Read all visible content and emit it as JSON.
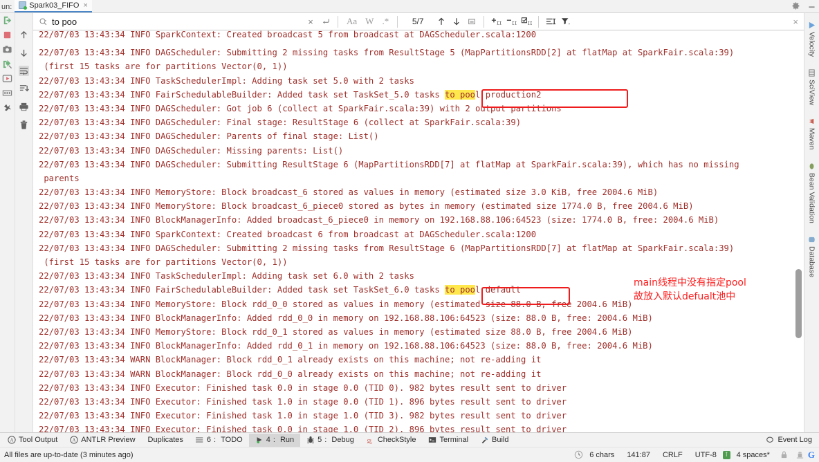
{
  "window": {
    "run_prefix": "un:",
    "tab_label": "Spark03_FIFO",
    "tab_close": "×",
    "gear_icon": "gear-icon",
    "minimize_icon": "minimize-icon"
  },
  "left_rail": {
    "icons": [
      {
        "name": "rerun-icon",
        "glyph": "rerun"
      },
      {
        "name": "stop-icon",
        "glyph": "stop"
      },
      {
        "name": "camera-icon",
        "glyph": "camera"
      },
      {
        "name": "rerun-failed-icon",
        "glyph": "rerun-failed"
      },
      {
        "name": "resume-icon",
        "glyph": "resume"
      },
      {
        "name": "layout-icon",
        "glyph": "layout"
      },
      {
        "name": "pin-icon",
        "glyph": "pin"
      }
    ],
    "icons2": [
      {
        "name": "scroll-up-icon",
        "glyph": "arrow-up"
      },
      {
        "name": "scroll-down-icon",
        "glyph": "arrow-down"
      },
      {
        "name": "soft-wrap-icon",
        "glyph": "soft-wrap",
        "selected": true
      },
      {
        "name": "scroll-to-end-icon",
        "glyph": "scroll-end"
      },
      {
        "name": "print-icon",
        "glyph": "printer"
      },
      {
        "name": "clear-all-icon",
        "glyph": "trash"
      }
    ]
  },
  "findbar": {
    "search_icon": "search-icon",
    "query": "to poo",
    "clear_label": "×",
    "history_label": "↵",
    "match_case_label": "Aa",
    "words_label": "W",
    "regex_label": ".*",
    "count": "5/7",
    "prev_label": "↑",
    "next_label": "↓",
    "select_all_label": "select-all",
    "filter_add_label": "add-filter",
    "filter_remove_label": "remove-filter",
    "filter_check_label": "check-filter",
    "indent_label": "indent",
    "funnel_label": "funnel",
    "close_label": "×"
  },
  "console": {
    "highlight_term": "to poo",
    "lines": [
      {
        "pre": "22/07/03 13:43:34 INFO SparkContext: Created broadcast 5 from broadcast at DAGScheduler.scala:1200",
        "clip": true
      },
      {
        "pre": "22/07/03 13:43:34 INFO DAGScheduler: Submitting 2 missing tasks from ResultStage 5 (MapPartitionsRDD[2] at flatMap at SparkFair.scala:39)"
      },
      {
        "pre": " (first 15 tasks are for partitions Vector(0, 1))"
      },
      {
        "pre": "22/07/03 13:43:34 INFO TaskSchedulerImpl: Adding task set 5.0 with 2 tasks"
      },
      {
        "pre": "22/07/03 13:43:34 INFO FairSchedulableBuilder: Added task set TaskSet_5.0 tasks ",
        "hl": "to poo",
        "post": "l production2"
      },
      {
        "pre": "22/07/03 13:43:34 INFO DAGScheduler: Got job 6 (collect at SparkFair.scala:39) with 2 output partitions"
      },
      {
        "pre": "22/07/03 13:43:34 INFO DAGScheduler: Final stage: ResultStage 6 (collect at SparkFair.scala:39)"
      },
      {
        "pre": "22/07/03 13:43:34 INFO DAGScheduler: Parents of final stage: List()"
      },
      {
        "pre": "22/07/03 13:43:34 INFO DAGScheduler: Missing parents: List()"
      },
      {
        "pre": "22/07/03 13:43:34 INFO DAGScheduler: Submitting ResultStage 6 (MapPartitionsRDD[7] at flatMap at SparkFair.scala:39), which has no missing"
      },
      {
        "pre": " parents"
      },
      {
        "pre": "22/07/03 13:43:34 INFO MemoryStore: Block broadcast_6 stored as values in memory (estimated size 3.0 KiB, free 2004.6 MiB)"
      },
      {
        "pre": "22/07/03 13:43:34 INFO MemoryStore: Block broadcast_6_piece0 stored as bytes in memory (estimated size 1774.0 B, free 2004.6 MiB)"
      },
      {
        "pre": "22/07/03 13:43:34 INFO BlockManagerInfo: Added broadcast_6_piece0 in memory on 192.168.88.106:64523 (size: 1774.0 B, free: 2004.6 MiB)"
      },
      {
        "pre": "22/07/03 13:43:34 INFO SparkContext: Created broadcast 6 from broadcast at DAGScheduler.scala:1200"
      },
      {
        "pre": "22/07/03 13:43:34 INFO DAGScheduler: Submitting 2 missing tasks from ResultStage 6 (MapPartitionsRDD[7] at flatMap at SparkFair.scala:39)"
      },
      {
        "pre": " (first 15 tasks are for partitions Vector(0, 1))"
      },
      {
        "pre": "22/07/03 13:43:34 INFO TaskSchedulerImpl: Adding task set 6.0 with 2 tasks"
      },
      {
        "pre": "22/07/03 13:43:34 INFO FairSchedulableBuilder: Added task set TaskSet_6.0 tasks ",
        "hl": "to poo",
        "post": "l default"
      },
      {
        "pre": "22/07/03 13:43:34 INFO MemoryStore: Block rdd_0_0 stored as values in memory (estimated size 88.0 B, free 2004.6 MiB)"
      },
      {
        "pre": "22/07/03 13:43:34 INFO BlockManagerInfo: Added rdd_0_0 in memory on 192.168.88.106:64523 (size: 88.0 B, free: 2004.6 MiB)"
      },
      {
        "pre": "22/07/03 13:43:34 INFO MemoryStore: Block rdd_0_1 stored as values in memory (estimated size 88.0 B, free 2004.6 MiB)"
      },
      {
        "pre": "22/07/03 13:43:34 INFO BlockManagerInfo: Added rdd_0_1 in memory on 192.168.88.106:64523 (size: 88.0 B, free: 2004.6 MiB)"
      },
      {
        "pre": "22/07/03 13:43:34 WARN BlockManager: Block rdd_0_1 already exists on this machine; not re-adding it"
      },
      {
        "pre": "22/07/03 13:43:34 WARN BlockManager: Block rdd_0_0 already exists on this machine; not re-adding it"
      },
      {
        "pre": "22/07/03 13:43:34 INFO Executor: Finished task 0.0 in stage 0.0 (TID 0). 982 bytes result sent to driver"
      },
      {
        "pre": "22/07/03 13:43:34 INFO Executor: Finished task 1.0 in stage 0.0 (TID 1). 896 bytes result sent to driver"
      },
      {
        "pre": "22/07/03 13:43:34 INFO Executor: Finished task 1.0 in stage 1.0 (TID 3). 982 bytes result sent to driver"
      },
      {
        "pre": "22/07/03 13:43:34 INFO Executor: Finished task 0.0 in stage 1.0 (TID 2). 896 bytes result sent to driver"
      }
    ],
    "annotations": {
      "note_line1": "main线程中没有指定pool",
      "note_line2": "故放入默认defualt池中",
      "note_color": "#ff1d1d",
      "box_color": "#ee1c1c"
    }
  },
  "right_rail": {
    "items": [
      {
        "label": "Velocity",
        "icon": "velocity-icon"
      },
      {
        "label": "SciView",
        "icon": "sciview-icon"
      },
      {
        "label": "Maven",
        "icon": "maven-icon"
      },
      {
        "label": "Bean Validation",
        "icon": "bean-icon"
      },
      {
        "label": "Database",
        "icon": "database-icon"
      }
    ]
  },
  "tool_windows": [
    {
      "label": "Tool Output",
      "icon": "antlr-icon",
      "num": "",
      "active": false
    },
    {
      "label": "ANTLR Preview",
      "icon": "antlr-icon",
      "num": "",
      "active": false
    },
    {
      "label": "Duplicates",
      "icon": "",
      "num": "",
      "active": false
    },
    {
      "label": "TODO",
      "icon": "todo-icon",
      "num": "6",
      "active": false
    },
    {
      "label": "Run",
      "icon": "run-icon",
      "num": "4",
      "active": true
    },
    {
      "label": "Debug",
      "icon": "debug-icon",
      "num": "5",
      "active": false
    },
    {
      "label": "CheckStyle",
      "icon": "checkstyle-icon",
      "num": "",
      "active": false
    },
    {
      "label": "Terminal",
      "icon": "terminal-icon",
      "num": "",
      "active": false
    },
    {
      "label": "Build",
      "icon": "build-icon",
      "num": "",
      "active": false
    }
  ],
  "event_log": {
    "label": "Event Log",
    "icon": "event-log-icon"
  },
  "status": {
    "message": "All files are up-to-date (3 minutes ago)",
    "chars": "6 chars",
    "caret": "141:87",
    "line_sep": "CRLF",
    "encoding": "UTF-8",
    "read_only_badge": "⊺",
    "indent": "4 spaces*",
    "lock_icon": "lock-icon",
    "inspector_icon": "inspector-icon",
    "google_icon": "G"
  }
}
